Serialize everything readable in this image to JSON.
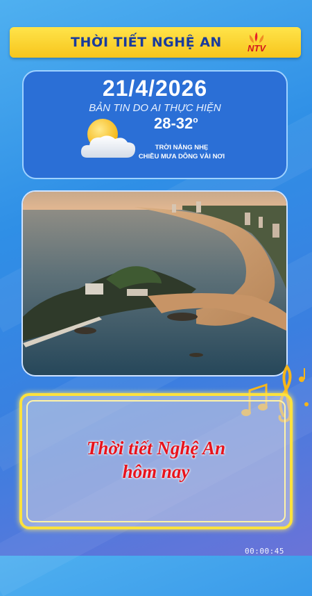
{
  "header": {
    "title": "THỜI TIẾT NGHỆ AN",
    "logo_text": "NTV"
  },
  "weather": {
    "date": "21/4/2026",
    "subtitle": "BẢN TIN DO AI THỰC HIỆN",
    "temperature": "28-32",
    "degree_mark": "o",
    "condition_line1": "TRỜI NẮNG NHẸ",
    "condition_line2": "CHIỀU MƯA DÔNG VÀI NƠI",
    "icon": "partly-sunny-icon"
  },
  "photo": {
    "icon": "coastline-photo"
  },
  "caption": {
    "line1": "Thời tiết Nghệ An",
    "line2": "hôm nay"
  },
  "player": {
    "timestamp": "00:00:45"
  },
  "colors": {
    "title_bar": "#f7c51c",
    "title_text": "#1a3b9c",
    "card_bg": "#2b6fd6",
    "caption_text": "#e8131c",
    "frame": "#ffe23c"
  }
}
